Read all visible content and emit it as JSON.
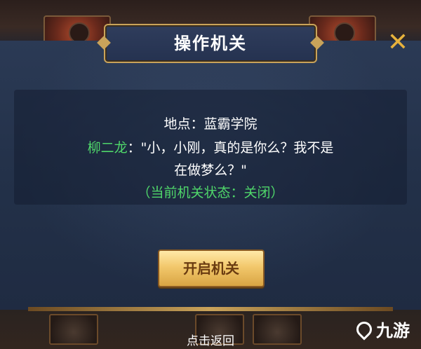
{
  "dialog": {
    "title": "操作机关",
    "close_glyph": "✕",
    "location_line": "地点：蓝霸学院",
    "speaker": "柳二龙",
    "speech_line1": "：\"小，小刚，真的是你么？我不是",
    "speech_line2": "在做梦么？\"",
    "status_line": "（当前机关状态：关闭）",
    "open_button_label": "开启机关"
  },
  "footer": {
    "return_hint": "点击返回"
  },
  "watermark": {
    "text": "九游",
    "icon": "jiuyou-logo-icon"
  },
  "colors": {
    "accent_gold": "#c9a35a",
    "speaker_green": "#4fd66a",
    "close_yellow": "#e7b23c"
  }
}
